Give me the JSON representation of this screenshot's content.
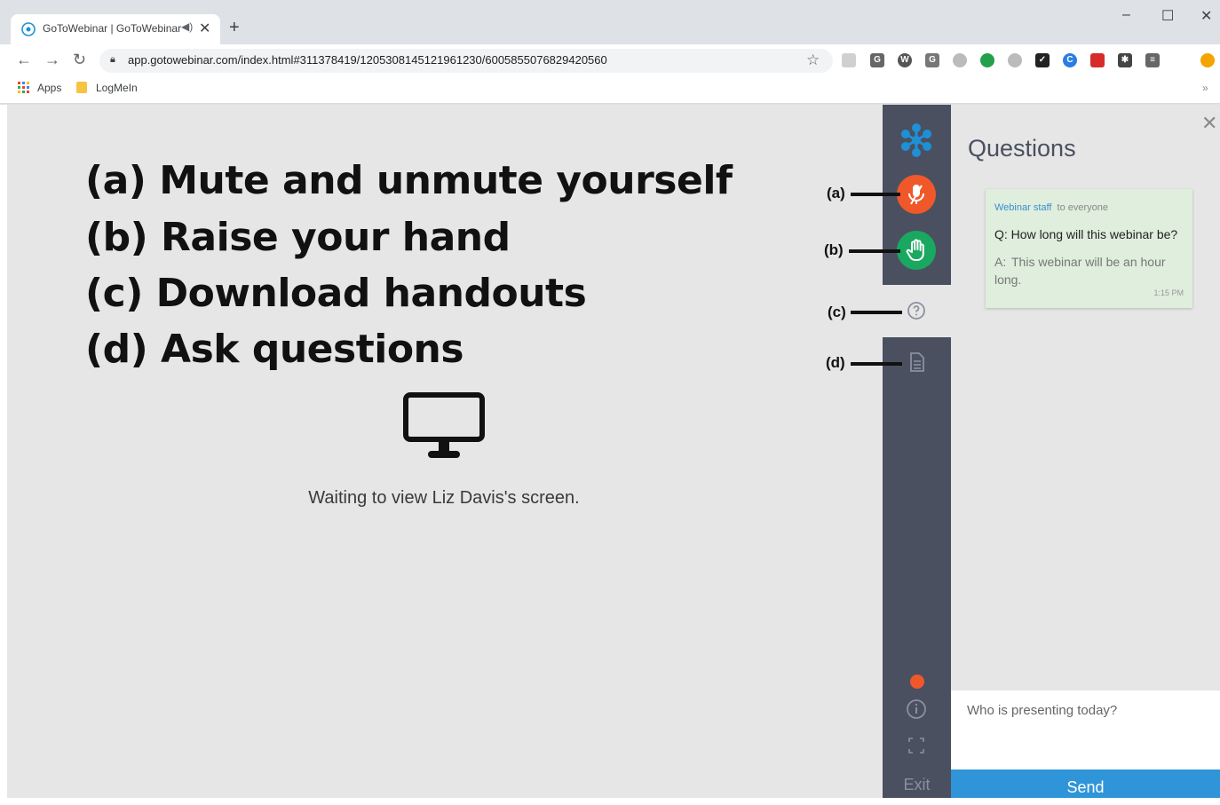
{
  "browser": {
    "tab_title": "GoToWebinar | GoToWebinar",
    "new_tab": "+",
    "win_min": "–",
    "win_max": "☐",
    "win_close": "✕",
    "url": "app.gotowebinar.com/index.html#311378419/1205308145121961230/6005855076829420560",
    "bookmarks": [
      "Apps",
      "LogMeIn"
    ],
    "bookmarks_more": "»"
  },
  "annotations": {
    "lines": [
      "(a) Mute and unmute yourself",
      "(b) Raise your hand",
      "(c) Download handouts",
      "(d) Ask questions"
    ],
    "markers": [
      "(a)",
      "(b)",
      "(c)",
      "(d)"
    ]
  },
  "stage": {
    "waiting_text": "Waiting to view Liz Davis's screen."
  },
  "rail": {
    "exit_label": "Exit",
    "colors": {
      "rail": "#4a5060",
      "mute": "#f0582a",
      "hand": "#1aa860",
      "logo": "#1e90d6"
    }
  },
  "questions": {
    "title": "Questions",
    "close": "✕",
    "card": {
      "from": "Webinar staff",
      "to": "to everyone",
      "q_label": "Q:",
      "question": "How long will this webinar be?",
      "a_label": "A:",
      "answer": "This webinar will be an hour long.",
      "time": "1:15 PM"
    },
    "input_value": "Who is presenting today?",
    "send_label": "Send"
  }
}
